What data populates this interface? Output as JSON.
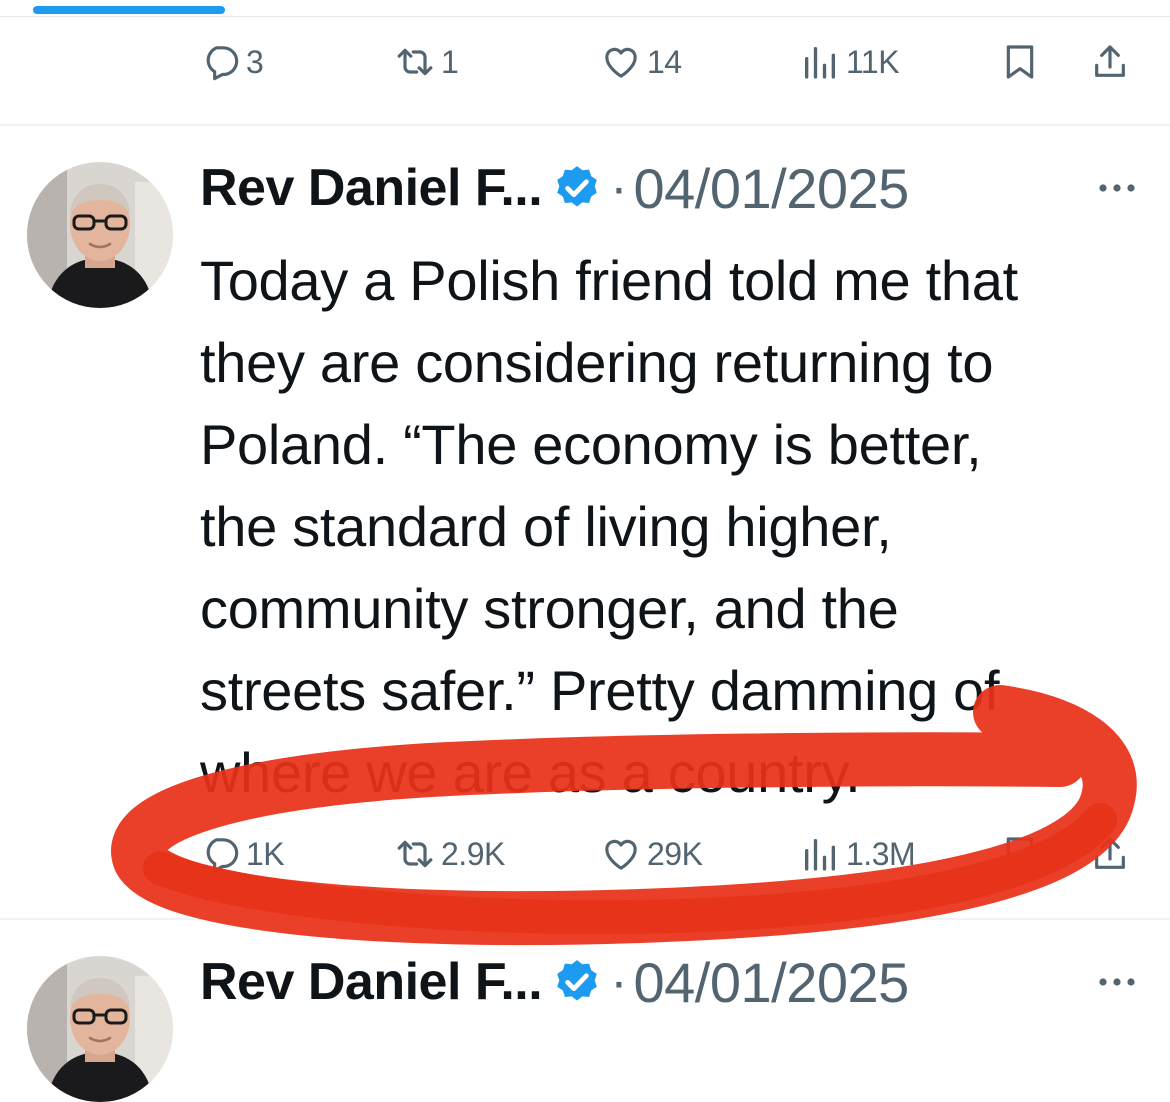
{
  "top_tweet_actions": {
    "replies": "3",
    "reposts": "1",
    "likes": "14",
    "views": "11K"
  },
  "main_tweet": {
    "author": "Rev Daniel F...",
    "separator": "·",
    "date": "04/01/2025",
    "lines": [
      "Today a Polish friend told me that",
      "they are considering returning to",
      "Poland. “The economy is better,",
      "the standard of living higher,",
      "community stronger, and the",
      "streets safer.” Pretty damming of",
      "where we are as a country."
    ],
    "actions": {
      "replies": "1K",
      "reposts": "2.9K",
      "likes": "29K",
      "views": "1.3M"
    }
  },
  "next_tweet": {
    "author": "Rev Daniel F...",
    "separator": "·",
    "date": "04/01/2025"
  },
  "colors": {
    "accent": "#1d9bf0",
    "muted_text": "#536471",
    "primary_text": "#0f1419",
    "annotation_red": "#e8321a"
  },
  "icons": [
    "reply-icon",
    "repost-icon",
    "like-icon",
    "views-icon",
    "bookmark-icon",
    "share-icon",
    "verified-badge-icon",
    "more-options-icon"
  ]
}
